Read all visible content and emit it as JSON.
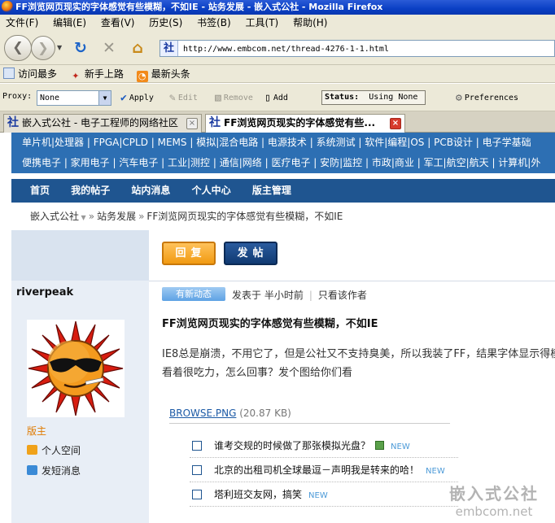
{
  "window": {
    "title": "FF浏览网页现实的字体感觉有些模糊，不如IE - 站务发展 - 嵌入式公社 - Mozilla Firefox"
  },
  "menu": [
    "文件(F)",
    "编辑(E)",
    "查看(V)",
    "历史(S)",
    "书签(B)",
    "工具(T)",
    "帮助(H)"
  ],
  "nav": {
    "url": "http://www.embcom.net/thread-4276-1-1.html",
    "site_glyph": "社"
  },
  "bookmarks": [
    {
      "label": "访问最多",
      "icon": "page-icon"
    },
    {
      "label": "新手上路",
      "icon": "firefox-icon"
    },
    {
      "label": "最新头条",
      "icon": "rss-icon"
    }
  ],
  "proxy": {
    "label": "Proxy:",
    "value": "None",
    "apply": "Apply",
    "edit": "Edit",
    "remove": "Remove",
    "add": "Add",
    "status_label": "Status:",
    "status_value": "Using None",
    "preferences": "Preferences"
  },
  "tabs": [
    {
      "label": "嵌入式公社 - 电子工程师的网络社区",
      "active": false
    },
    {
      "label": "FF浏览网页现实的字体感觉有些...",
      "active": true
    }
  ],
  "site": {
    "cat_row1": "单片机|处理器 | FPGA|CPLD | MEMS | 模拟|混合电路 | 电源技术 | 系统测试 | 软件|编程|OS | PCB设计 | 电子学基础",
    "cat_row2": "便携电子 | 家用电子 | 汽车电子 | 工业|测控 | 通信|网络 | 医疗电子 | 安防|监控 | 市政|商业 | 军工|航空|航天 | 计算机|外",
    "main_nav": [
      "首页",
      "我的帖子",
      "站内消息",
      "个人中心",
      "版主管理"
    ],
    "breadcrumb": {
      "home": "嵌入式公社",
      "forum": "站务发展",
      "thread": "FF浏览网页现实的字体感觉有些模糊，不如IE"
    }
  },
  "buttons": {
    "reply": "回复",
    "post": "发帖"
  },
  "user": {
    "name": "riverpeak",
    "role": "版主",
    "space": "个人空间",
    "message": "发短消息"
  },
  "post": {
    "badge": "有新动态",
    "posted": "发表于 半小时前",
    "only_author": "只看该作者",
    "title": "FF浏览网页现实的字体感觉有些模糊，不如IE",
    "body": "IE8总是崩溃，不用它了，但是公社又不支持臭美，所以我装了FF，结果字体显示得模糊，看着很吃力，怎么回事？发个图给你们看",
    "attachment_name": "BROWSE.PNG",
    "attachment_size": "(20.87 KB)"
  },
  "ads": [
    {
      "text": "谁考交规的时候做了那张模拟光盘？",
      "tag": "NEW",
      "has_download": true
    },
    {
      "text": "北京的出租司机全球最逗－声明我是转来的哈！",
      "tag": "NEW",
      "has_download": false
    },
    {
      "text": "塔利班交友网，搞笑",
      "tag": "NEW",
      "has_download": false
    }
  ],
  "watermark": {
    "line1": "嵌入式公社",
    "line2": "embcom.net"
  },
  "colors": {
    "site_blue": "#2d6fb3",
    "nav_dark": "#1f5590",
    "reply_orange": "#f19a12",
    "role_orange": "#e07a00"
  }
}
